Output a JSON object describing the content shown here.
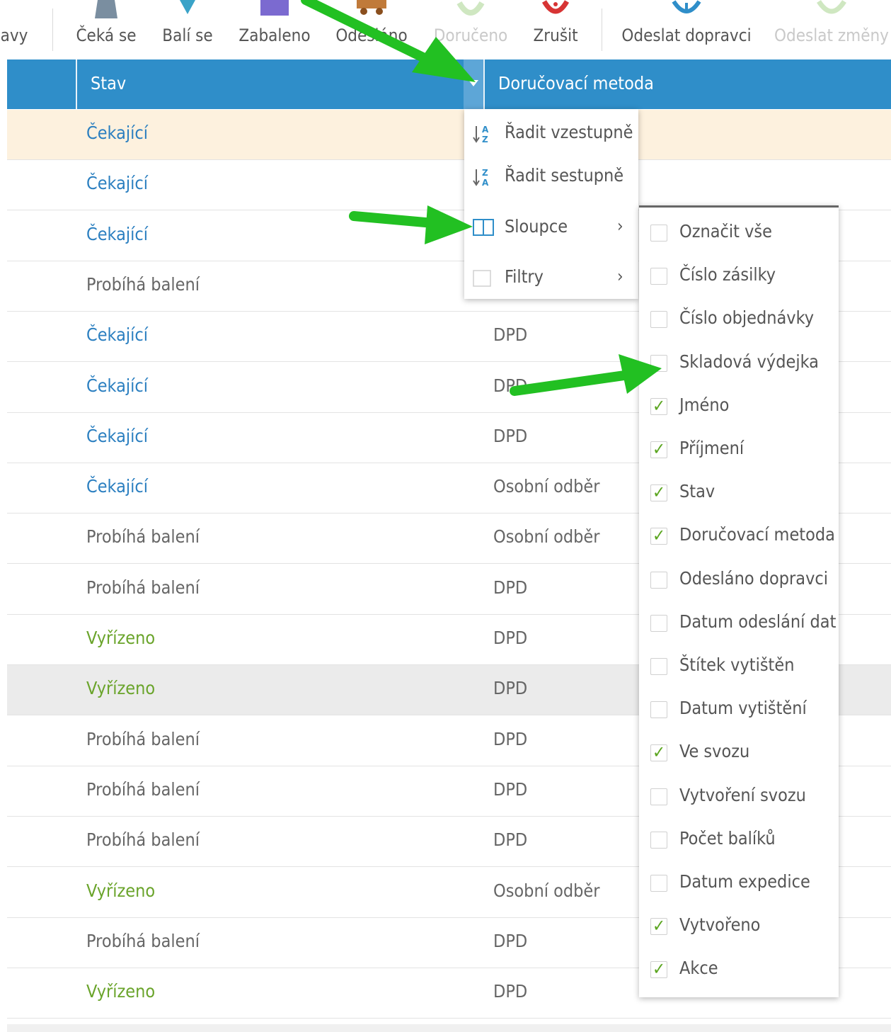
{
  "toolbar": {
    "items": [
      {
        "label": "avy",
        "disabled": false
      },
      {
        "label": "Čeká se",
        "disabled": false
      },
      {
        "label": "Balí se",
        "disabled": false
      },
      {
        "label": "Zabaleno",
        "disabled": false
      },
      {
        "label": "Odesláno",
        "disabled": false
      },
      {
        "label": "Doručeno",
        "disabled": true
      },
      {
        "label": "Zrušit",
        "disabled": false
      },
      {
        "label": "Odeslat dopravci",
        "disabled": false
      },
      {
        "label": "Odeslat změny",
        "disabled": true
      }
    ],
    "colors": {
      "zabaleno": "#7b6ad0",
      "zrusit": "#d73434",
      "odeslat": "#2f8ec9",
      "disabled": "#cfe7c1"
    }
  },
  "grid": {
    "header": {
      "stav": "Stav",
      "method": "Doručovací metoda"
    },
    "header_color": "#2f8ec9",
    "rows": [
      {
        "stav": "Čekající",
        "status": "blue",
        "method": ""
      },
      {
        "stav": "Čekající",
        "status": "blue",
        "method": ""
      },
      {
        "stav": "Čekající",
        "status": "blue",
        "method": ""
      },
      {
        "stav": "Probíhá balení",
        "status": "gray",
        "method": ""
      },
      {
        "stav": "Čekající",
        "status": "blue",
        "method": "DPD"
      },
      {
        "stav": "Čekající",
        "status": "blue",
        "method": "DPD"
      },
      {
        "stav": "Čekající",
        "status": "blue",
        "method": "DPD"
      },
      {
        "stav": "Čekající",
        "status": "blue",
        "method": "Osobní odběr"
      },
      {
        "stav": "Probíhá balení",
        "status": "gray",
        "method": "Osobní odběr"
      },
      {
        "stav": "Probíhá balení",
        "status": "gray",
        "method": "DPD"
      },
      {
        "stav": "Vyřízeno",
        "status": "green",
        "method": "DPD"
      },
      {
        "stav": "Vyřízeno",
        "status": "green",
        "method": "DPD"
      },
      {
        "stav": "Probíhá balení",
        "status": "gray",
        "method": "DPD"
      },
      {
        "stav": "Probíhá balení",
        "status": "gray",
        "method": "DPD"
      },
      {
        "stav": "Probíhá balení",
        "status": "gray",
        "method": "DPD"
      },
      {
        "stav": "Vyřízeno",
        "status": "green",
        "method": "Osobní odběr"
      },
      {
        "stav": "Probíhá balení",
        "status": "gray",
        "method": "DPD"
      },
      {
        "stav": "Vyřízeno",
        "status": "green",
        "method": "DPD"
      }
    ]
  },
  "column_menu": {
    "sort_asc": "Řadit vzestupně",
    "sort_desc": "Řadit sestupně",
    "columns": "Sloupce",
    "filters": "Filtry",
    "submenu_arrow": "›"
  },
  "columns_submenu": {
    "items": [
      {
        "label": "Označit vše",
        "checked": false
      },
      {
        "label": "Číslo zásilky",
        "checked": false
      },
      {
        "label": "Číslo objednávky",
        "checked": false
      },
      {
        "label": "Skladová výdejka",
        "checked": false
      },
      {
        "label": "Jméno",
        "checked": true
      },
      {
        "label": "Příjmení",
        "checked": true
      },
      {
        "label": "Stav",
        "checked": true
      },
      {
        "label": "Doručovací metoda",
        "checked": true
      },
      {
        "label": "Odesláno dopravci",
        "checked": false
      },
      {
        "label": "Datum odeslání dat",
        "checked": false
      },
      {
        "label": "Štítek vytištěn",
        "checked": false
      },
      {
        "label": "Datum vytištění",
        "checked": false
      },
      {
        "label": "Ve svozu",
        "checked": true
      },
      {
        "label": "Vytvoření svozu",
        "checked": false
      },
      {
        "label": "Počet balíků",
        "checked": false
      },
      {
        "label": "Datum expedice",
        "checked": false
      },
      {
        "label": "Vytvořeno",
        "checked": true
      },
      {
        "label": "Akce",
        "checked": true
      }
    ],
    "check_mark": "✓"
  },
  "annotation_arrow_color": "#22c022"
}
